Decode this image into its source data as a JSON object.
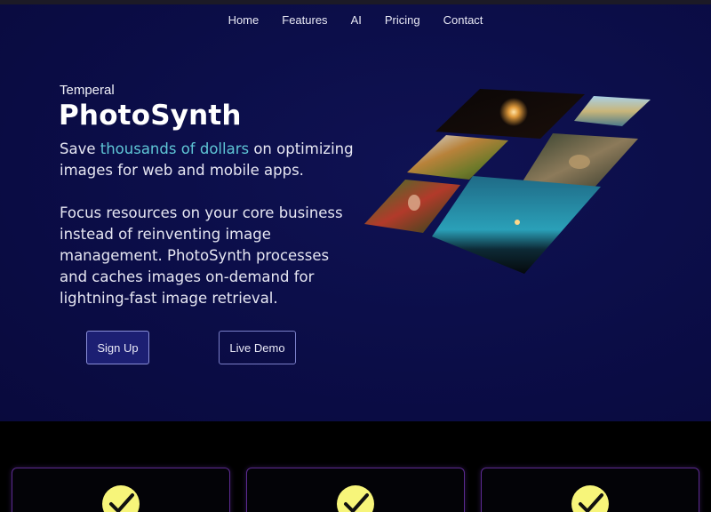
{
  "nav": {
    "items": [
      "Home",
      "Features",
      "AI",
      "Pricing",
      "Contact"
    ]
  },
  "hero": {
    "brand_small": "Temperal",
    "brand_big": "PhotoSynth",
    "tagline_pre": "Save ",
    "tagline_highlight": "thousands of dollars",
    "tagline_post": " on optimizing images for web and mobile apps.",
    "description": "Focus resources on your core business instead of reinventing image management. PhotoSynth processes and caches images on-demand for lightning-fast image retrieval.",
    "signup_label": "Sign Up",
    "demo_label": "Live Demo"
  },
  "colors": {
    "hero_bg": "#0b0d47",
    "highlight": "#5fc6d6",
    "card_border": "#5b2a8f",
    "check_fill": "#f7f57a"
  },
  "features": {
    "cards": [
      {
        "icon": "check-badge-icon"
      },
      {
        "icon": "check-badge-icon"
      },
      {
        "icon": "check-badge-icon"
      }
    ]
  }
}
